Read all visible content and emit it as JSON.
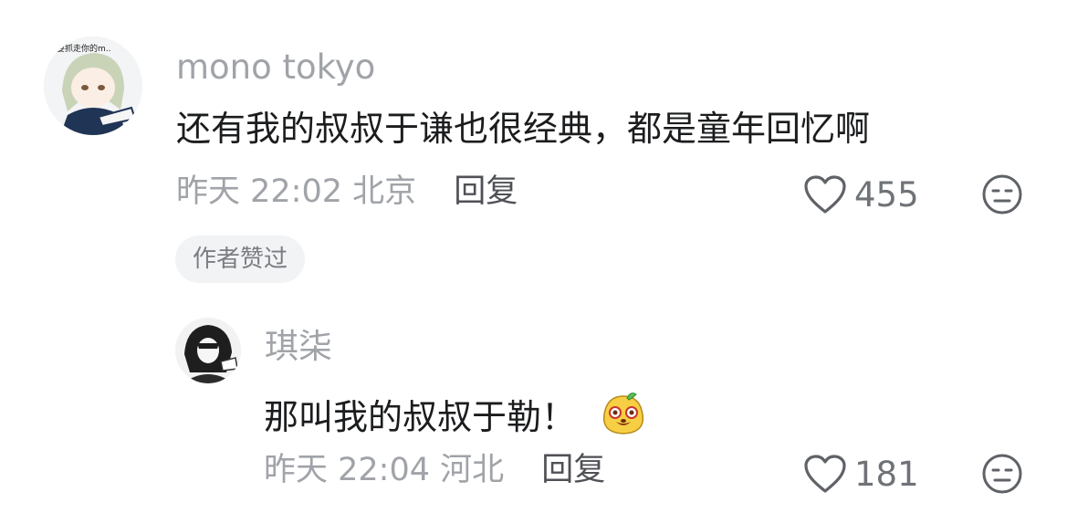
{
  "comment": {
    "username": "mono tokyo",
    "avatar_caption": "要抓走你的m..",
    "text": "还有我的叔叔于谦也很经典，都是童年回忆啊",
    "time": "昨天 22:02",
    "location": "北京",
    "reply_label": "回复",
    "like_count": "455",
    "author_liked_badge": "作者赞过"
  },
  "reply": {
    "username": "琪柒",
    "text": "那叫我的叔叔于勒！",
    "emoji": "cheeky-face-emoji",
    "time": "昨天 22:04",
    "location": "河北",
    "reply_label": "回复",
    "like_count": "181"
  },
  "icons": {
    "like": "heart-outline-icon",
    "dislike": "unamused-face-icon"
  },
  "colors": {
    "text_primary": "#1b1c1e",
    "text_secondary": "#a0a3a8",
    "reply_button": "#4f5156",
    "badge_bg": "#f2f3f5"
  }
}
